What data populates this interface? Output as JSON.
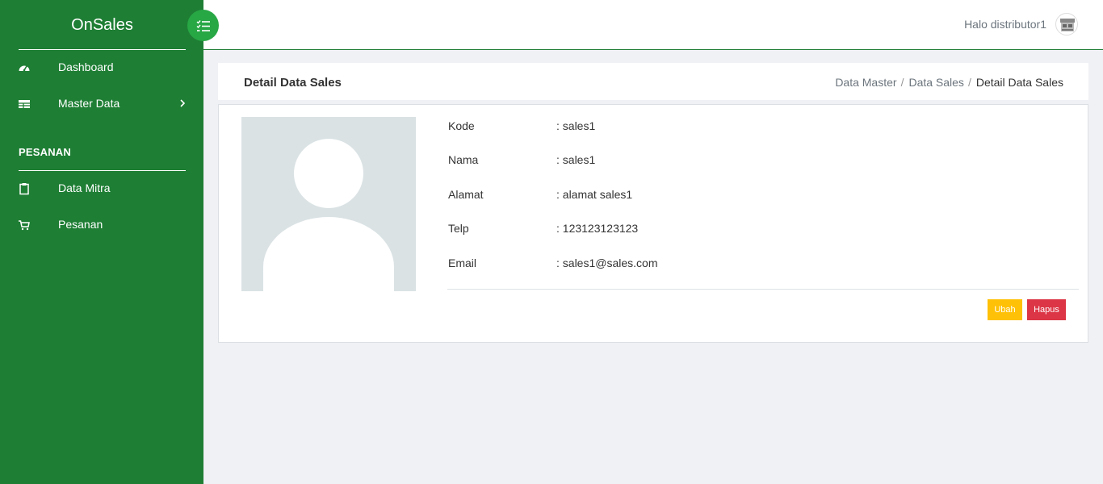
{
  "app": {
    "brand": "OnSales"
  },
  "sidebar": {
    "items": [
      {
        "label": "Dashboard",
        "icon": "speedometer-icon"
      },
      {
        "label": "Master Data",
        "icon": "table-icon"
      }
    ],
    "section_title": "PESANAN",
    "section_items": [
      {
        "label": "Data Mitra",
        "icon": "clipboard-icon"
      },
      {
        "label": "Pesanan",
        "icon": "cart-icon"
      }
    ]
  },
  "topbar": {
    "greeting": "Halo distributor1"
  },
  "page": {
    "title": "Detail Data Sales",
    "breadcrumb": [
      "Data Master",
      "Data Sales",
      "Detail Data Sales"
    ]
  },
  "detail": {
    "fields": [
      {
        "label": "Kode",
        "value": ": sales1"
      },
      {
        "label": "Nama",
        "value": ": sales1"
      },
      {
        "label": "Alamat",
        "value": ": alamat sales1"
      },
      {
        "label": "Telp",
        "value": ": 123123123123"
      },
      {
        "label": "Email",
        "value": ": sales1@sales.com"
      }
    ],
    "edit_label": "Ubah",
    "delete_label": "Hapus"
  },
  "colors": {
    "sidebar": "#1e7e34",
    "toggle": "#28a745",
    "edit": "#ffc107",
    "delete": "#dc3545"
  }
}
